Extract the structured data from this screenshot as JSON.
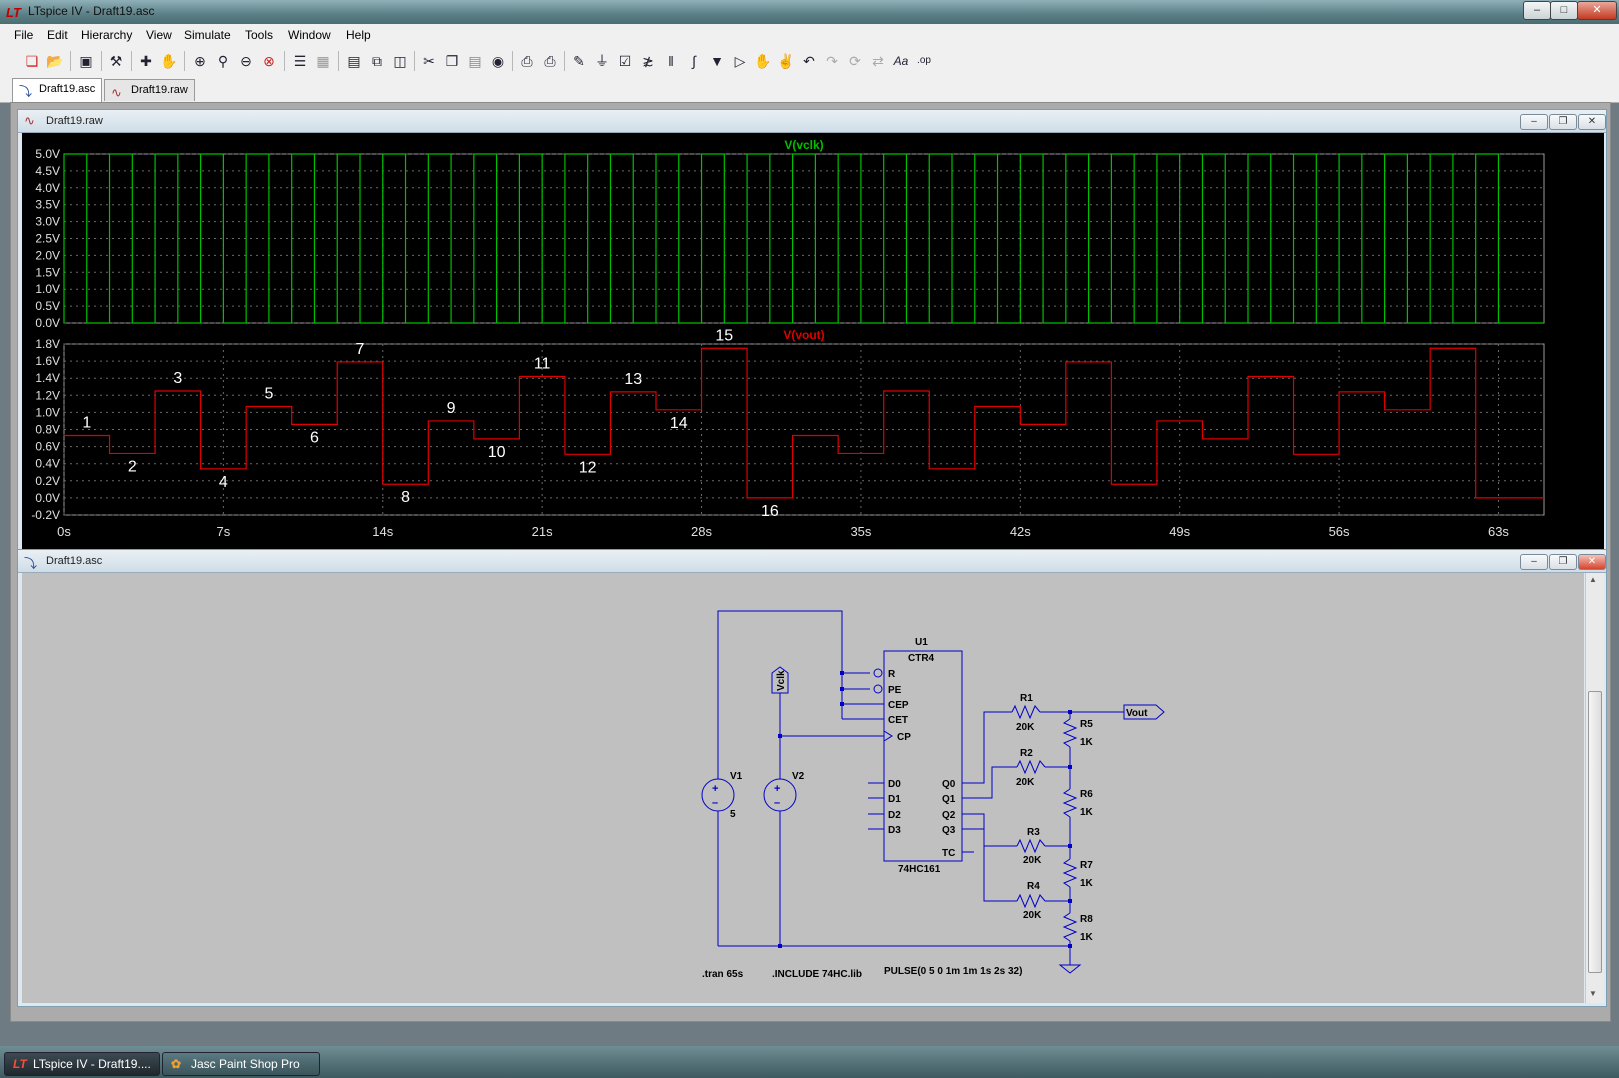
{
  "window": {
    "title": "LTspice IV - Draft19.asc"
  },
  "menubar": {
    "items": [
      "File",
      "Edit",
      "Hierarchy",
      "View",
      "Simulate",
      "Tools",
      "Window",
      "Help"
    ]
  },
  "toolbar": {
    "icons": [
      "new-schematic-icon",
      "open-icon",
      "save-icon",
      "control-panel-icon",
      "run-icon",
      "halt-icon",
      "zoom-in-icon",
      "zoom-pan-icon",
      "zoom-out-icon",
      "zoom-fit-icon",
      "autorange-icon",
      "grid-icon",
      "tile-horizontal-icon",
      "cascade-icon",
      "tile-vertical-icon",
      "cut-icon",
      "copy-icon",
      "paste-icon",
      "find-icon",
      "print-preview-icon",
      "print-icon",
      "draw-wire-icon",
      "ground-icon",
      "label-net-icon",
      "resistor-icon",
      "capacitor-icon",
      "inductor-icon",
      "diode-icon",
      "component-icon",
      "move-icon",
      "drag-icon",
      "undo-icon",
      "redo-icon",
      "rotate-icon",
      "mirror-icon",
      "text-icon",
      "spice-directive-icon"
    ]
  },
  "tabs": [
    {
      "label": "Draft19.asc",
      "icon": "schematic-icon"
    },
    {
      "label": "Draft19.raw",
      "icon": "waveform-icon"
    }
  ],
  "plot_window": {
    "title": "Draft19.raw"
  },
  "schematic_window": {
    "title": "Draft19.asc"
  },
  "chart_data": [
    {
      "type": "line",
      "title": "V(vclk)",
      "color": "#00c000",
      "ylim": [
        0,
        5.0
      ],
      "y_ticks": [
        "5.0V",
        "4.5V",
        "4.0V",
        "3.5V",
        "3.0V",
        "2.5V",
        "2.0V",
        "1.5V",
        "1.0V",
        "0.5V",
        "0.0V"
      ],
      "series": [
        {
          "name": "V(vclk)",
          "pulse": {
            "low": 0,
            "high": 5,
            "delay": 0,
            "on": 1,
            "period": 2,
            "cycles": 32
          }
        }
      ]
    },
    {
      "type": "line",
      "title": "V(vout)",
      "color": "#e00000",
      "ylim": [
        -0.2,
        1.8
      ],
      "xlim": [
        0,
        65
      ],
      "y_ticks": [
        "1.8V",
        "1.6V",
        "1.4V",
        "1.2V",
        "1.0V",
        "0.8V",
        "0.6V",
        "0.4V",
        "0.2V",
        "0.0V",
        "-0.2V"
      ],
      "x_ticks": [
        "0s",
        "7s",
        "14s",
        "21s",
        "28s",
        "35s",
        "42s",
        "49s",
        "56s",
        "63s"
      ],
      "step_x": [
        0,
        2,
        4,
        6,
        8,
        10,
        12,
        14,
        16,
        18,
        20,
        22,
        24,
        26,
        28,
        30,
        32,
        34,
        36,
        38,
        40,
        42,
        44,
        46,
        48,
        50,
        52,
        54,
        56,
        58,
        60,
        62,
        65
      ],
      "step_y": [
        0.73,
        0.52,
        1.25,
        0.34,
        1.07,
        0.86,
        1.59,
        0.16,
        0.9,
        0.69,
        1.42,
        0.51,
        1.24,
        1.03,
        1.75,
        0.0,
        0.73,
        0.52,
        1.25,
        0.34,
        1.07,
        0.86,
        1.59,
        0.16,
        0.9,
        0.69,
        1.42,
        0.51,
        1.24,
        1.03,
        1.75,
        0.0
      ],
      "annotations": [
        "1",
        "2",
        "3",
        "4",
        "5",
        "6",
        "7",
        "8",
        "9",
        "10",
        "11",
        "12",
        "13",
        "14",
        "15",
        "16"
      ]
    }
  ],
  "schematic": {
    "u1_ref": "U1",
    "u1_type": "CTR4",
    "u1_part": "74HC161",
    "pins_left": [
      "R",
      "PE",
      "CEP",
      "CET",
      "CP",
      "D0",
      "D1",
      "D2",
      "D3"
    ],
    "pins_right": [
      "Q0",
      "Q1",
      "Q2",
      "Q3",
      "TC"
    ],
    "v1_name": "V1",
    "v1_value": "5",
    "v2_name": "V2",
    "vclk_label": "Vclk",
    "vout_label": "Vout",
    "resistors": [
      {
        "name": "R1",
        "value": "20K"
      },
      {
        "name": "R2",
        "value": "20K"
      },
      {
        "name": "R3",
        "value": "20K"
      },
      {
        "name": "R4",
        "value": "20K"
      },
      {
        "name": "R5",
        "value": "1K"
      },
      {
        "name": "R6",
        "value": "1K"
      },
      {
        "name": "R7",
        "value": "1K"
      },
      {
        "name": "R8",
        "value": "1K"
      }
    ],
    "directive_tran": ".tran 65s",
    "directive_include": ".INCLUDE 74HC.lib",
    "v2_value": "PULSE(0 5 0 1m 1m 1s 2s 32)"
  },
  "taskbar": {
    "items": [
      "LTspice IV - Draft19....",
      "Jasc Paint Shop Pro"
    ]
  }
}
